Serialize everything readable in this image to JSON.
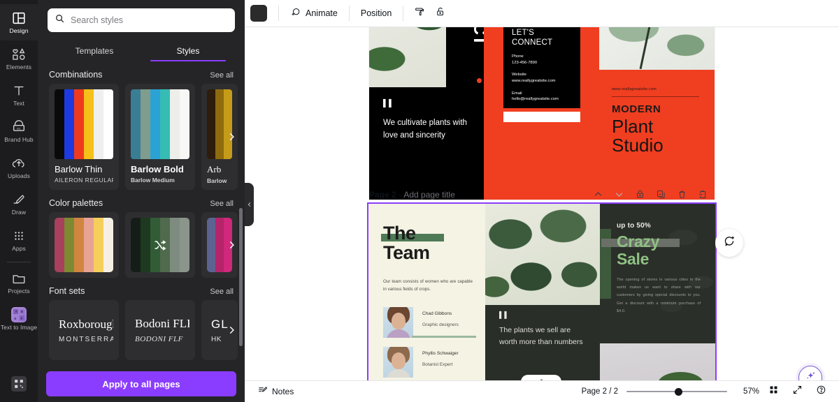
{
  "rail": {
    "items": [
      {
        "label": "Design",
        "icon": "design-icon",
        "active": true
      },
      {
        "label": "Elements",
        "icon": "elements-icon",
        "active": false
      },
      {
        "label": "Text",
        "icon": "text-icon",
        "active": false
      },
      {
        "label": "Brand Hub",
        "icon": "brand-hub-icon",
        "active": false
      },
      {
        "label": "Uploads",
        "icon": "uploads-icon",
        "active": false
      },
      {
        "label": "Draw",
        "icon": "draw-icon",
        "active": false
      },
      {
        "label": "Apps",
        "icon": "apps-icon",
        "active": false
      },
      {
        "label": "Projects",
        "icon": "projects-icon",
        "active": false
      },
      {
        "label": "Text to Image",
        "icon": "text-to-image-icon",
        "active": false
      }
    ]
  },
  "panel": {
    "search": {
      "placeholder": "Search styles",
      "value": ""
    },
    "tabs": [
      {
        "label": "Templates",
        "active": false
      },
      {
        "label": "Styles",
        "active": true
      }
    ],
    "sections": {
      "combinations": {
        "title": "Combinations",
        "see_all": "See all",
        "cards": [
          {
            "name": "Barlow Thin",
            "sub": "AILERON REGULAR",
            "colors": [
              "#0a0a0a",
              "#1d3ae0",
              "#f03a1e",
              "#f5c01a",
              "#efefef",
              "#ffffff"
            ]
          },
          {
            "name": "Barlow Bold",
            "sub": "Barlow Medium",
            "colors": [
              "#3a7e96",
              "#7f9c8c",
              "#2aa3d4",
              "#35bcb4",
              "#eceeea",
              "#f7f7f5"
            ]
          },
          {
            "name": "Arb",
            "sub": "Barlow",
            "colors": [
              "#2e1c0c",
              "#8f6b0e",
              "#c59b1a"
            ]
          }
        ]
      },
      "color_palettes": {
        "title": "Color palettes",
        "see_all": "See all",
        "cards": [
          {
            "colors": [
              "#a8405e",
              "#7d8a31",
              "#d18540",
              "#e8a394",
              "#f5cf5c",
              "#f6efe4"
            ],
            "shuffle": false
          },
          {
            "colors": [
              "#161d18",
              "#1d3a20",
              "#325c36",
              "#4f6a4c",
              "#7e8c80",
              "#8b958b"
            ],
            "shuffle": true
          },
          {
            "colors": [
              "#5b6391",
              "#b5246a",
              "#d0287a"
            ],
            "shuffle": false
          }
        ]
      },
      "font_sets": {
        "title": "Font sets",
        "see_all": "See all",
        "cards": [
          {
            "primary": "Roxborough",
            "secondary": "MONTSERRAT",
            "style": "serif"
          },
          {
            "primary": "Bodoni FLF",
            "secondary": "BODONI FLF",
            "style": "serif-italic"
          },
          {
            "primary": "GL",
            "secondary": "HK",
            "style": "sans"
          }
        ]
      }
    },
    "apply_button": "Apply to all pages",
    "accent_color": "#8b3dff"
  },
  "toolbar": {
    "color_chip": "#2b2b2b",
    "animate": "Animate",
    "position": "Position",
    "paint_icon": "paint-roller-icon",
    "lock_icon": "lock-icon"
  },
  "canvas": {
    "page1": {
      "vertical_text": "DUCT",
      "quote_mark": "❝",
      "quote": "We cultivate plants with love and sincerity",
      "connect_title": "LET'S CONNECT",
      "contacts": [
        {
          "label": "Phone",
          "value": "123-456-7890"
        },
        {
          "label": "Website",
          "value": "www.reallygreatsite.com"
        },
        {
          "label": "Email",
          "value": "hello@reallygreatsite.com"
        }
      ],
      "url": "www.reallygreatsite.com",
      "modern": "MODERN",
      "plant": "Plant",
      "studio": "Studio",
      "colors": {
        "red": "#f03e20",
        "black": "#000000"
      }
    },
    "page2_header": {
      "page_label": "Page 2 -",
      "title_placeholder": "Add page title",
      "actions": [
        {
          "name": "move-up-icon",
          "label": "Move page up"
        },
        {
          "name": "move-down-icon",
          "label": "Move page down"
        },
        {
          "name": "lock-icon",
          "label": "Lock page"
        },
        {
          "name": "duplicate-icon",
          "label": "Duplicate page"
        },
        {
          "name": "delete-icon",
          "label": "Delete page"
        },
        {
          "name": "add-page-icon",
          "label": "Add page"
        }
      ]
    },
    "page2": {
      "the": "The",
      "team": "Team",
      "desc": "Our team consists of women who are capable in various fields of crops.",
      "members": [
        {
          "name": "Chad Gibbons",
          "role": "Graphic designers"
        },
        {
          "name": "Phyllis Schwaiger",
          "role": "Botanist Expert"
        }
      ],
      "quote_mark": "❝",
      "quote": "The plants we sell are worth more than numbers",
      "upto": "up to 50%",
      "crazy": "Crazy",
      "sale": "Sale",
      "sale_body": "The opening of stores in various cities in the world makes us want to share with our customers by giving special discounts to you. Get a discount with a minimum purchase of $4.0.",
      "colors": {
        "cream": "#f4f3e4",
        "dark": "#2a2e28",
        "green_accent": "#8fc183",
        "bar_green": "#4e7a56"
      }
    },
    "selection_color": "#8b3dff"
  },
  "floating": {
    "comment_icon": "add-comment-icon",
    "magic_icon": "magic-sparkle-icon"
  },
  "statusbar": {
    "notes": "Notes",
    "page_count": "Page 2 / 2",
    "zoom": "57%",
    "grid_icon": "grid-view-icon",
    "fullscreen_icon": "fullscreen-icon",
    "help_icon": "help-icon"
  }
}
